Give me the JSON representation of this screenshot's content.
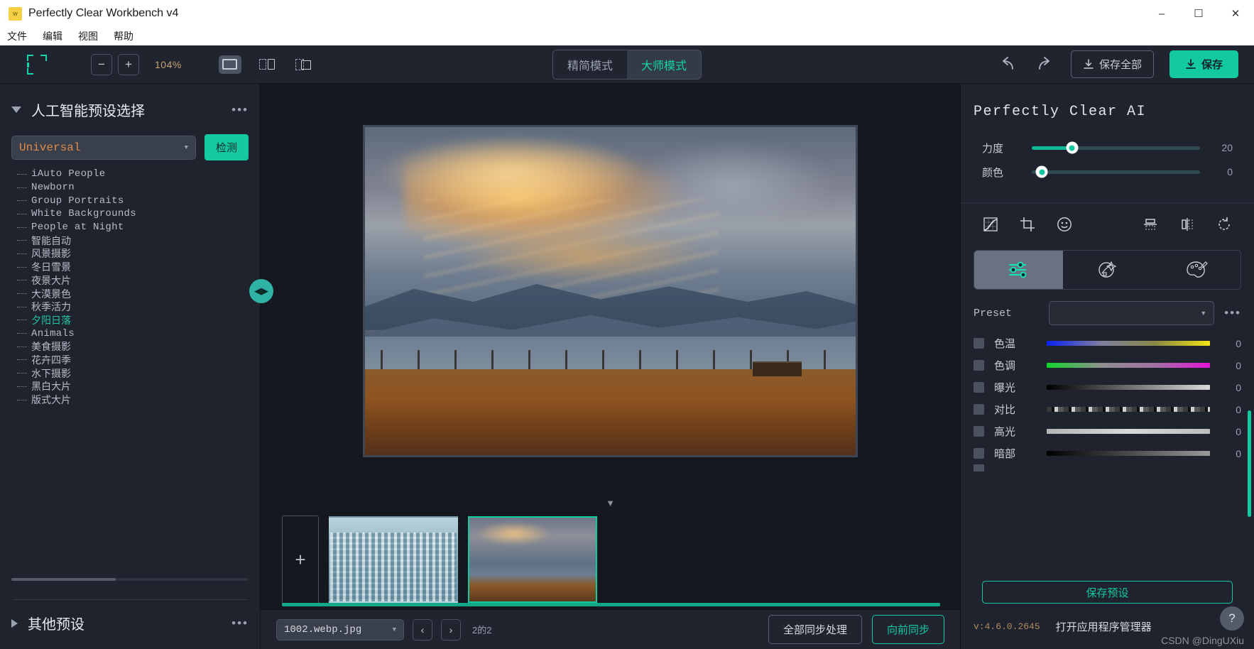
{
  "titlebar": {
    "title": "Perfectly Clear Workbench v4",
    "minimize": "–",
    "maximize": "☐",
    "close": "✕"
  },
  "menubar": {
    "items": [
      "文件",
      "编辑",
      "视图",
      "帮助"
    ]
  },
  "toolbar": {
    "zoom_out": "−",
    "zoom_in": "+",
    "zoom_level": "104%",
    "modes": [
      {
        "label": "精简模式",
        "active": false
      },
      {
        "label": "大师模式",
        "active": true
      }
    ],
    "undo_icon": "undo-icon",
    "redo_icon": "redo-icon",
    "save_all_label": "保存全部",
    "save_label": "保存"
  },
  "left_panel": {
    "section_title": "人工智能预设选择",
    "preset_select_value": "Universal",
    "detect_label": "检测",
    "tree_items": [
      {
        "label": "iAuto People",
        "latin": true,
        "selected": false
      },
      {
        "label": "Newborn",
        "latin": true,
        "selected": false
      },
      {
        "label": "Group Portraits",
        "latin": true,
        "selected": false
      },
      {
        "label": "White Backgrounds",
        "latin": true,
        "selected": false
      },
      {
        "label": "People at Night",
        "latin": true,
        "selected": false
      },
      {
        "label": "智能自动",
        "latin": false,
        "selected": false
      },
      {
        "label": "风景摄影",
        "latin": false,
        "selected": false
      },
      {
        "label": "冬日雪景",
        "latin": false,
        "selected": false
      },
      {
        "label": "夜景大片",
        "latin": false,
        "selected": false
      },
      {
        "label": "大漠景色",
        "latin": false,
        "selected": false
      },
      {
        "label": "秋季活力",
        "latin": false,
        "selected": false
      },
      {
        "label": "夕阳日落",
        "latin": false,
        "selected": true
      },
      {
        "label": "Animals",
        "latin": true,
        "selected": false
      },
      {
        "label": "美食摄影",
        "latin": false,
        "selected": false
      },
      {
        "label": "花卉四季",
        "latin": false,
        "selected": false
      },
      {
        "label": "水下摄影",
        "latin": false,
        "selected": false
      },
      {
        "label": "黑白大片",
        "latin": false,
        "selected": false
      },
      {
        "label": "版式大片",
        "latin": false,
        "selected": false
      }
    ],
    "other_presets_title": "其他预设",
    "menu_dots": "•••"
  },
  "statusbar": {
    "filename": "1002.webp.jpg",
    "prev": "‹",
    "next": "›",
    "page_label": "2的2",
    "sync_all_label": "全部同步处理",
    "sync_forward_label": "向前同步",
    "add_tile": "+"
  },
  "right_panel": {
    "title": "Perfectly Clear AI",
    "ai_sliders": [
      {
        "label": "力度",
        "value": "20",
        "pct": 24
      },
      {
        "label": "颜色",
        "value": "0",
        "pct": 6
      }
    ],
    "tool_icons": [
      "curves-icon",
      "crop-icon",
      "face-icon",
      "flip-vertical-icon",
      "flip-horizontal-icon",
      "rotate-icon"
    ],
    "tabs": [
      {
        "name": "sliders-tab",
        "active": true
      },
      {
        "name": "ai-magic-tab",
        "active": false
      },
      {
        "name": "palette-tab",
        "active": false
      }
    ],
    "preset_label": "Preset",
    "preset_value": "",
    "preset_dots": "•••",
    "adjustments": [
      {
        "label": "色温",
        "value": "0",
        "grad": "g-temp"
      },
      {
        "label": "色调",
        "value": "0",
        "grad": "g-tint"
      },
      {
        "label": "曝光",
        "value": "0",
        "grad": "g-exp"
      },
      {
        "label": "对比",
        "value": "0",
        "grad": "g-con"
      },
      {
        "label": "高光",
        "value": "0",
        "grad": "g-high"
      },
      {
        "label": "暗部",
        "value": "0",
        "grad": "g-sh"
      }
    ],
    "save_preset_label": "保存预设",
    "version": "v:4.6.0.2645",
    "app_manager_label": "打开应用程序管理器",
    "help_icon": "?",
    "watermark": "CSDN @DingUXiu"
  },
  "colors": {
    "accent_teal": "#12c9a0",
    "panel_bg": "#1e232d",
    "canvas_bg": "#15181f",
    "orange_text": "#e08b4a"
  }
}
